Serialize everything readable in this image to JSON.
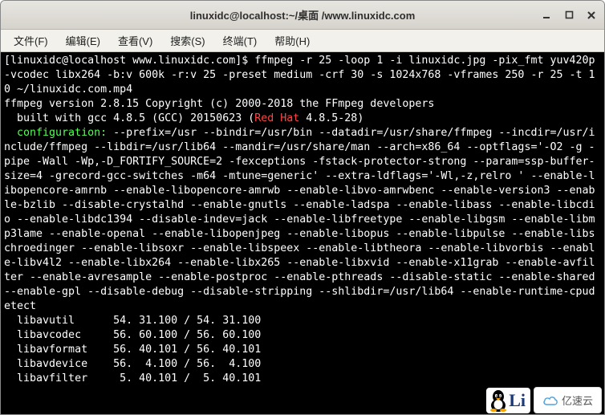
{
  "titlebar": {
    "title": "linuxidc@localhost:~/桌面 /www.linuxidc.com"
  },
  "menubar": {
    "file": "文件(F)",
    "edit": "编辑(E)",
    "view": "查看(V)",
    "search": "搜索(S)",
    "terminal": "终端(T)",
    "help": "帮助(H)"
  },
  "terminal": {
    "line1_prompt": "[linuxidc@localhost www.linuxidc.com]$ ",
    "line1_cmd": "ffmpeg -r 25 -loop 1 -i linuxidc.jpg -pix_fmt yuv420p -vcodec libx264 -b:v 600k -r:v 25 -preset medium -crf 30 -s 1024x768 -vframes 250 -r 25 -t 10 ~/linuxidc.com.mp4",
    "line2": "ffmpeg version 2.8.15 Copyright (c) 2000-2018 the FFmpeg developers",
    "line3a": "  built with gcc 4.8.5 (GCC) 20150623 (",
    "line3_redhat": "Red Hat",
    "line3b": " 4.8.5-28)",
    "cfg_label": "  configuration:",
    "cfg_body": " --prefix=/usr --bindir=/usr/bin --datadir=/usr/share/ffmpeg --incdir=/usr/include/ffmpeg --libdir=/usr/lib64 --mandir=/usr/share/man --arch=x86_64 --optflags='-O2 -g -pipe -Wall -Wp,-D_FORTIFY_SOURCE=2 -fexceptions -fstack-protector-strong --param=ssp-buffer-size=4 -grecord-gcc-switches -m64 -mtune=generic' --extra-ldflags='-Wl,-z,relro ' --enable-libopencore-amrnb --enable-libopencore-amrwb --enable-libvo-amrwbenc --enable-version3 --enable-bzlib --disable-crystalhd --enable-gnutls --enable-ladspa --enable-libass --enable-libcdio --enable-libdc1394 --disable-indev=jack --enable-libfreetype --enable-libgsm --enable-libmp3lame --enable-openal --enable-libopenjpeg --enable-libopus --enable-libpulse --enable-libschroedinger --enable-libsoxr --enable-libspeex --enable-libtheora --enable-libvorbis --enable-libv4l2 --enable-libx264 --enable-libx265 --enable-libxvid --enable-x11grab --enable-avfilter --enable-avresample --enable-postproc --enable-pthreads --disable-static --enable-shared --enable-gpl --disable-debug --disable-stripping --shlibdir=/usr/lib64 --enable-runtime-cpudetect",
    "lib1": "  libavutil      54. 31.100 / 54. 31.100",
    "lib2": "  libavcodec     56. 60.100 / 56. 60.100",
    "lib3": "  libavformat    56. 40.101 / 56. 40.101",
    "lib4": "  libavdevice    56.  4.100 / 56.  4.100",
    "lib5": "  libavfilter     5. 40.101 /  5. 40.101"
  },
  "watermark": {
    "linux_text": "Li",
    "cloud_text": "亿速云"
  }
}
